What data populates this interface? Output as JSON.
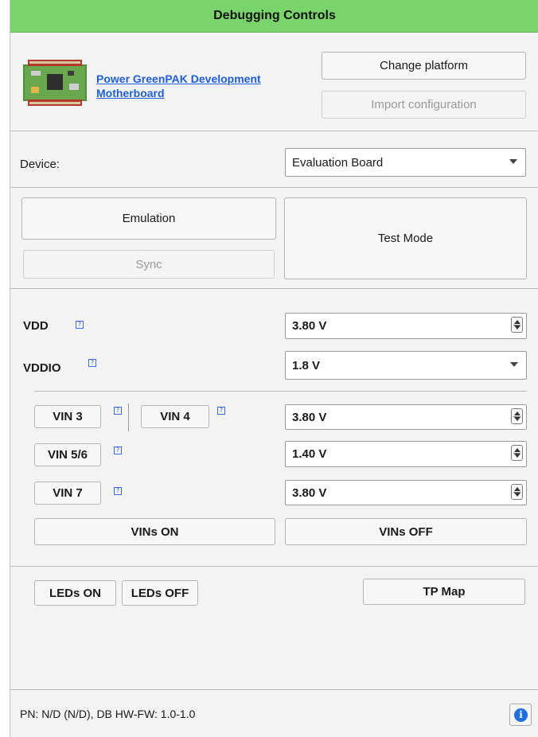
{
  "header": {
    "title": "Debugging Controls"
  },
  "platform": {
    "name": "Power GreenPAK Development Motherboard",
    "change_label": "Change platform",
    "import_label": "Import configuration"
  },
  "device": {
    "label": "Device:",
    "value": "Evaluation Board"
  },
  "mode": {
    "emulation_label": "Emulation",
    "sync_label": "Sync",
    "test_mode_label": "Test Mode"
  },
  "power": {
    "vdd_label": "VDD",
    "vdd_value": "3.80 V",
    "vddio_label": "VDDIO",
    "vddio_value": "1.8 V"
  },
  "vins": {
    "vin3_label": "VIN 3",
    "vin4_label": "VIN 4",
    "vin34_value": "3.80 V",
    "vin56_label": "VIN 5/6",
    "vin56_value": "1.40 V",
    "vin7_label": "VIN 7",
    "vin7_value": "3.80 V",
    "on_label": "VINs ON",
    "off_label": "VINs OFF"
  },
  "leds": {
    "on_label": "LEDs ON",
    "off_label": "LEDs OFF",
    "tp_map_label": "TP Map"
  },
  "status": {
    "text": "PN: N/D (N/D), DB HW-FW: 1.0-1.0",
    "info_icon": "info-icon"
  },
  "colors": {
    "header": "#7bd46b",
    "link": "#1f5fd6",
    "info": "#1d6fe0"
  }
}
